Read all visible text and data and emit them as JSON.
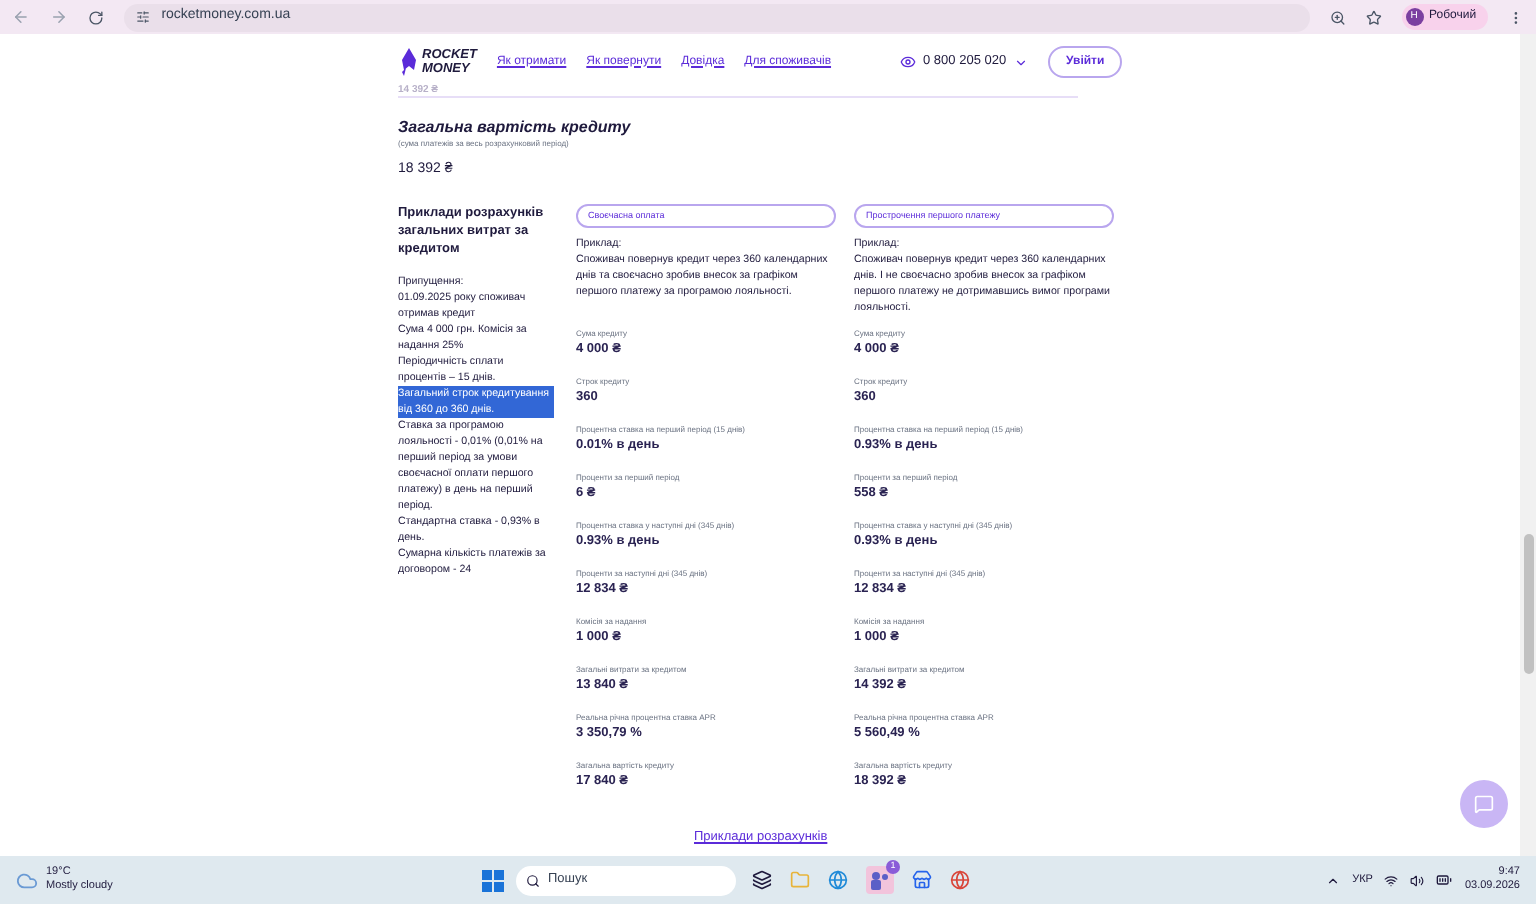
{
  "browser": {
    "url": "rocketmoney.com.ua",
    "profile_initial": "Н",
    "profile_name": "Робочий"
  },
  "header": {
    "logo_lines": [
      "ROCKET",
      "MONEY"
    ],
    "nav": [
      "Як отримати",
      "Як повернути",
      "Довідка",
      "Для споживачів"
    ],
    "phone": "0 800 205 020",
    "login": "Увійти"
  },
  "previous_value": "14 392 ₴",
  "total": {
    "title": "Загальна вартість кредиту",
    "subtitle": "(сума платежів за весь розрахунковий період)",
    "value": "18 392 ₴"
  },
  "examples": {
    "heading": "Приклади розрахунків загальних витрат за кредитом",
    "notes": [
      {
        "text": "Припущення:",
        "selected": false
      },
      {
        "text": "01.09.2025 року споживач отримав кредит",
        "selected": false
      },
      {
        "text": "Сума 4 000 грн. Комісія за надання 25%",
        "selected": false
      },
      {
        "text": "Періодичність сплати процентів – 15 днів.",
        "selected": false
      },
      {
        "text": "Загальний строк кредитування від 360 до 360 днів.",
        "selected": true
      },
      {
        "text": "Ставка за програмою лояльності - 0,01% (0,01% на перший період за умови своєчасної оплати першого платежу) в день на перший період.",
        "selected": false
      },
      {
        "text": "Стандартна ставка - 0,93% в день.",
        "selected": false
      },
      {
        "text": "Сумарна кількість платежів за договором - 24",
        "selected": false
      }
    ],
    "scenarios": [
      {
        "title": "Своєчасна оплата",
        "example_label": "Приклад:",
        "description": "Споживач повернув кредит через 360 календарних днів та своєчасно зробив внесок за графіком першого платежу за програмою лояльності.",
        "metrics": [
          {
            "label": "Сума кредиту",
            "value": "4 000 ₴"
          },
          {
            "label": "Строк кредиту",
            "value": "360"
          },
          {
            "label": "Процентна ставка на перший період (15 днів)",
            "value": "0.01% в день"
          },
          {
            "label": "Проценти за перший період",
            "value": "6 ₴"
          },
          {
            "label": "Процентна ставка у наступні дні (345 днів)",
            "value": "0.93% в день"
          },
          {
            "label": "Проценти за наступні дні (345 днів)",
            "value": "12 834 ₴"
          },
          {
            "label": "Комісія за надання",
            "value": "1 000 ₴"
          },
          {
            "label": "Загальні витрати за кредитом",
            "value": "13 840 ₴"
          },
          {
            "label": "Реальна річна процентна ставка APR",
            "value": "3 350,79 %"
          },
          {
            "label": "Загальна вартість кредиту",
            "value": "17 840 ₴"
          }
        ]
      },
      {
        "title": "Прострочення першого платежу",
        "example_label": "Приклад:",
        "description": "Споживач повернув кредит через 360 календарних днів. І не своєчасно зробив внесок за графіком першого платежу не дотримавшись вимог програми лояльності.",
        "metrics": [
          {
            "label": "Сума кредиту",
            "value": "4 000 ₴"
          },
          {
            "label": "Строк кредиту",
            "value": "360"
          },
          {
            "label": "Процентна ставка на перший період (15 днів)",
            "value": "0.93% в день"
          },
          {
            "label": "Проценти за перший період",
            "value": "558 ₴"
          },
          {
            "label": "Процентна ставка у наступні дні (345 днів)",
            "value": "0.93% в день"
          },
          {
            "label": "Проценти за наступні дні (345 днів)",
            "value": "12 834 ₴"
          },
          {
            "label": "Комісія за надання",
            "value": "1 000 ₴"
          },
          {
            "label": "Загальні витрати за кредитом",
            "value": "14 392 ₴"
          },
          {
            "label": "Реальна річна процентна ставка APR",
            "value": "5 560,49 %"
          },
          {
            "label": "Загальна вартість кредиту",
            "value": "18 392 ₴"
          }
        ]
      }
    ],
    "link": "Приклади розрахунків"
  },
  "taskbar": {
    "temperature": "19°C",
    "weather": "Mostly cloudy",
    "search": "Пошук",
    "badge": "1",
    "language": "УКР",
    "time": "9:47",
    "date": "03.09.2026"
  }
}
